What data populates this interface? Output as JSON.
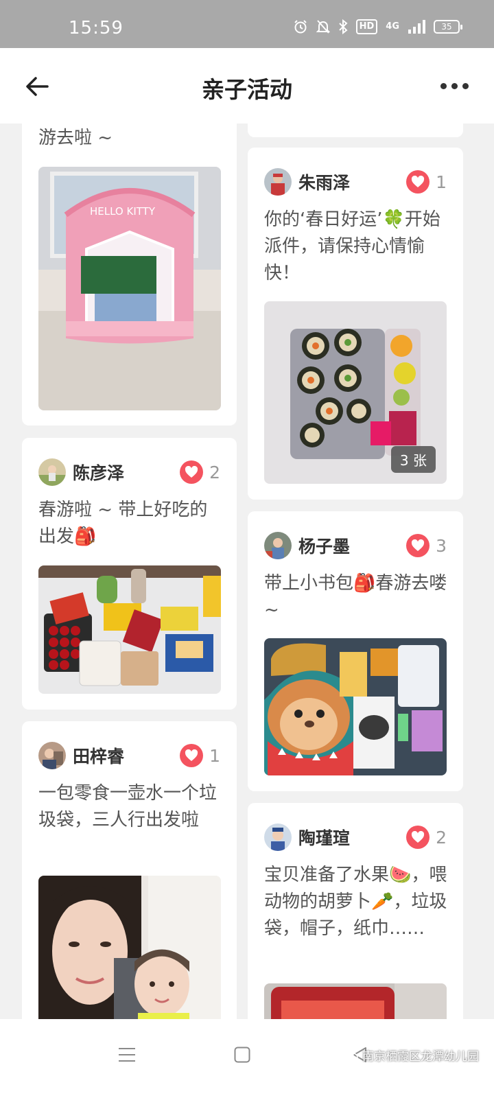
{
  "status_bar": {
    "time": "15:59",
    "network": "4G",
    "hd": "HD",
    "battery": "35"
  },
  "header": {
    "title": "亲子活动",
    "back_icon": "back-arrow-icon",
    "more_icon": "more-dots-icon"
  },
  "feed": {
    "left": [
      {
        "text": "游去啦 ~"
      },
      {
        "author": "陈彦泽",
        "likes": "2",
        "text": "春游啦 ~ 带上好吃的出发🎒"
      },
      {
        "author": "田梓睿",
        "likes": "1",
        "text": "一包零食一壶水一个垃圾袋，三人行出发啦"
      }
    ],
    "right": [
      {
        "author": "朱雨泽",
        "likes": "1",
        "text": "你的‘春日好运’🍀开始派件，请保持心情愉快！",
        "photo_count": "3 张"
      },
      {
        "author": "杨子墨",
        "likes": "3",
        "text": "带上小书包🎒春游去喽~"
      },
      {
        "author": "陶瑾瑄",
        "likes": "2",
        "text": "宝贝准备了水果🍉，喂动物的胡萝卜🥕，垃圾袋，帽子，纸巾……"
      }
    ]
  },
  "nav_bar": {
    "watermark": "南京栖霞区龙潭幼儿园"
  },
  "colors": {
    "like": "#f4535f",
    "status_bar": "#a9a9a9",
    "background": "#f1f1f1"
  }
}
